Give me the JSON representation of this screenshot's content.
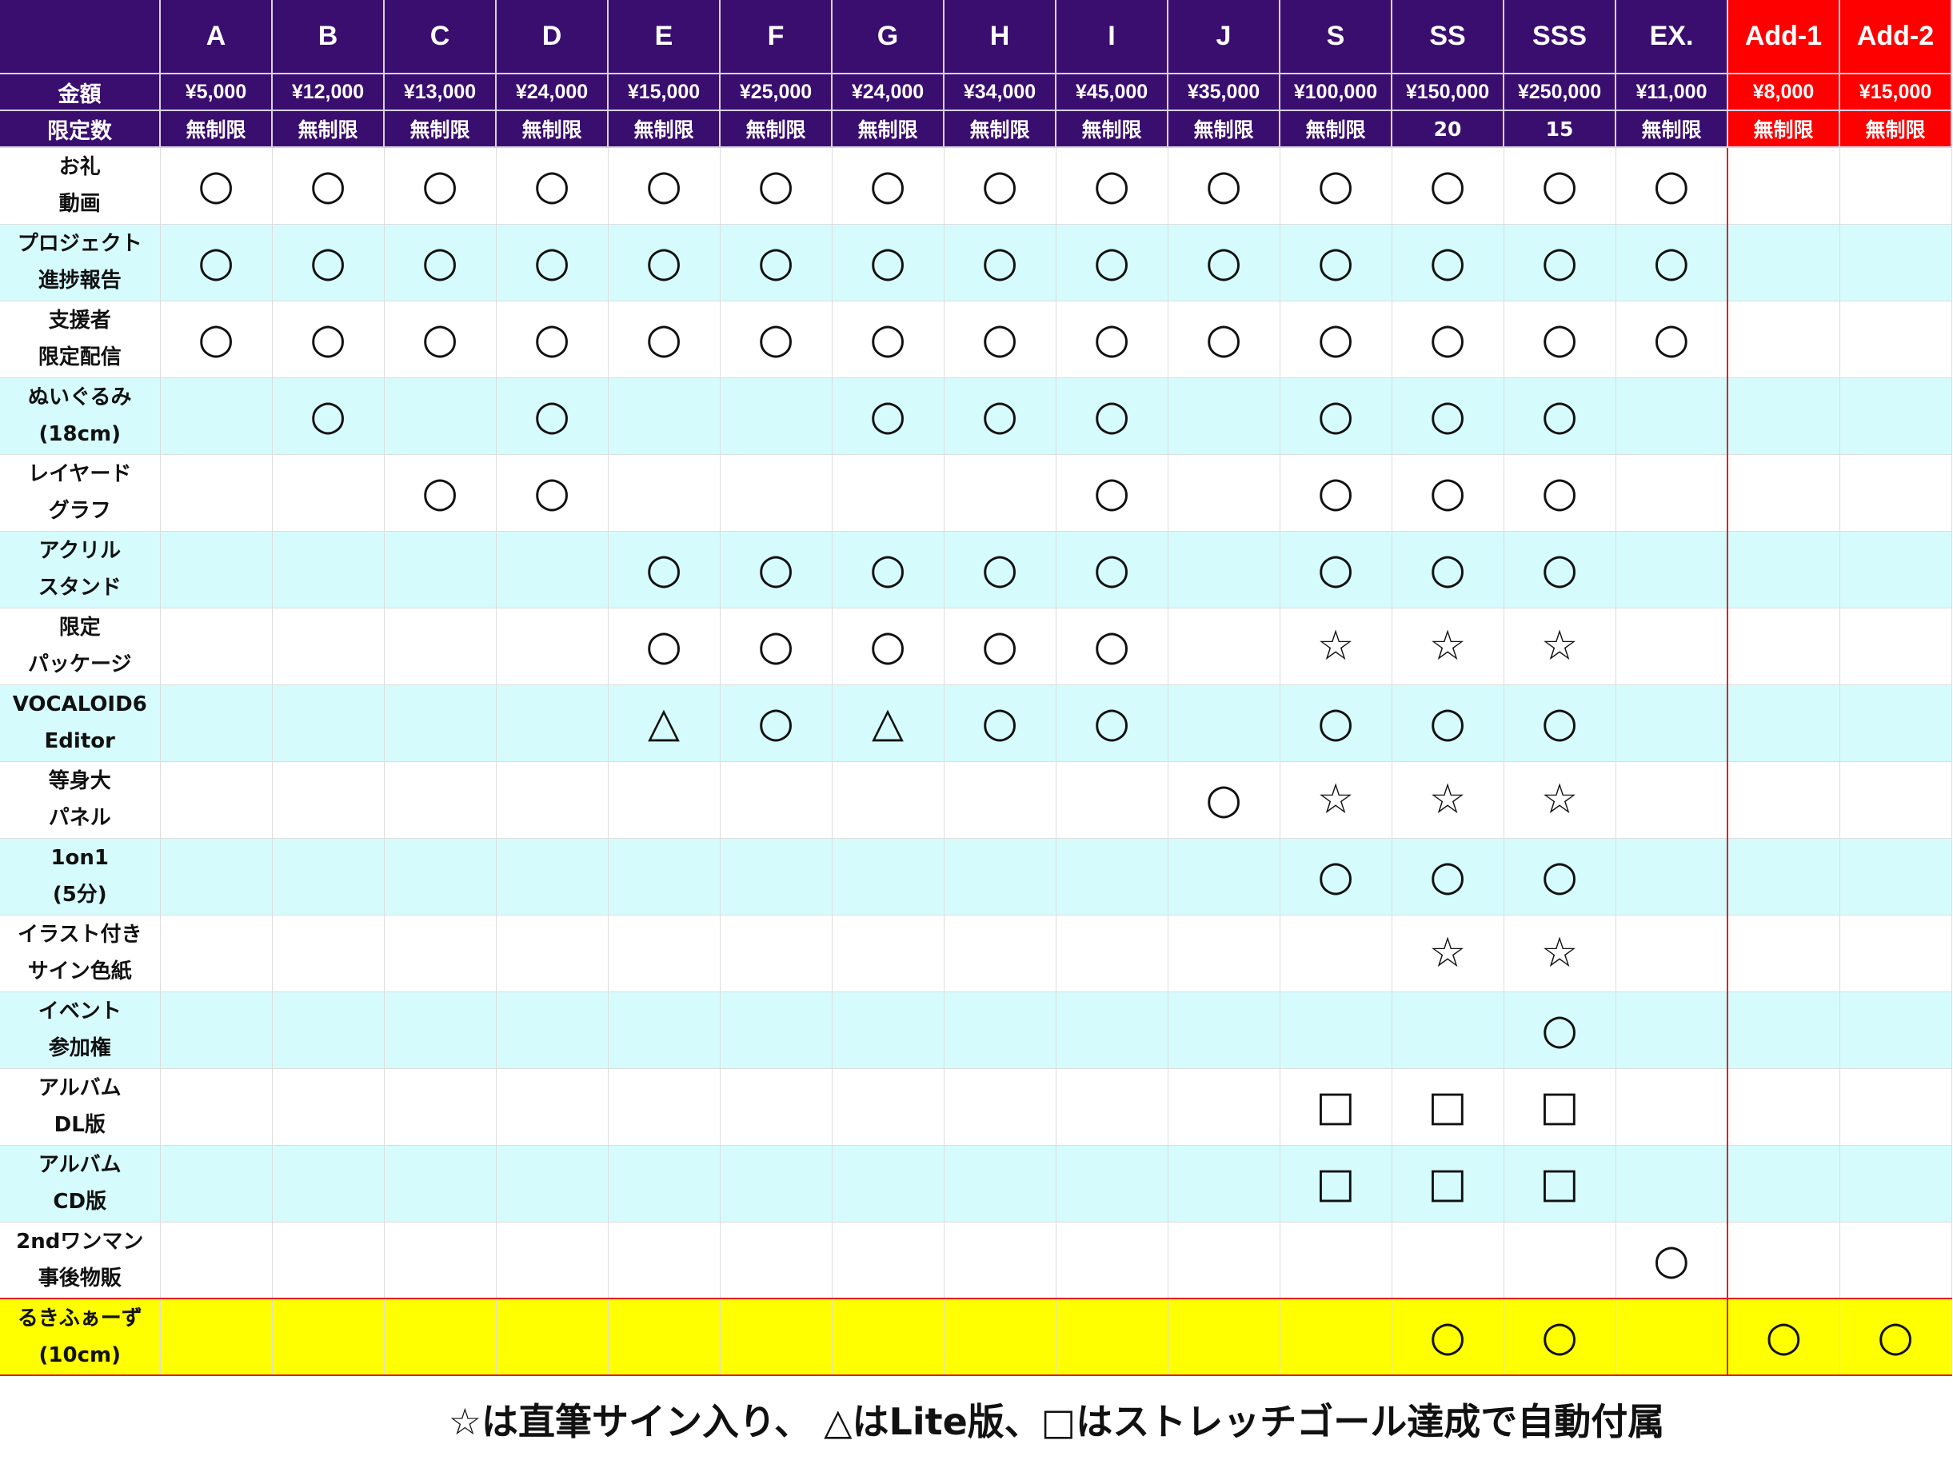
{
  "corner": {
    "price_label": "金額",
    "limit_label": "限定数"
  },
  "tiers": [
    {
      "name": "A",
      "price": "¥5,000",
      "limit": "無制限"
    },
    {
      "name": "B",
      "price": "¥12,000",
      "limit": "無制限"
    },
    {
      "name": "C",
      "price": "¥13,000",
      "limit": "無制限"
    },
    {
      "name": "D",
      "price": "¥24,000",
      "limit": "無制限"
    },
    {
      "name": "E",
      "price": "¥15,000",
      "limit": "無制限"
    },
    {
      "name": "F",
      "price": "¥25,000",
      "limit": "無制限"
    },
    {
      "name": "G",
      "price": "¥24,000",
      "limit": "無制限"
    },
    {
      "name": "H",
      "price": "¥34,000",
      "limit": "無制限"
    },
    {
      "name": "I",
      "price": "¥45,000",
      "limit": "無制限"
    },
    {
      "name": "J",
      "price": "¥35,000",
      "limit": "無制限"
    },
    {
      "name": "S",
      "price": "¥100,000",
      "limit": "無制限"
    },
    {
      "name": "SS",
      "price": "¥150,000",
      "limit": "20"
    },
    {
      "name": "SSS",
      "price": "¥250,000",
      "limit": "15"
    },
    {
      "name": "EX.",
      "price": "¥11,000",
      "limit": "無制限"
    },
    {
      "name": "Add-1",
      "price": "¥8,000",
      "limit": "無制限"
    },
    {
      "name": "Add-2",
      "price": "¥15,000",
      "limit": "無制限"
    }
  ],
  "colors": {
    "header": "#3a0e6f",
    "add_header": "#ff0000",
    "alt_row": "#d6fbfd",
    "highlight_row": "#ffff00",
    "add_border": "#e02020"
  },
  "rows": [
    {
      "label_1": "お礼",
      "label_2": "動画",
      "marks": [
        "○",
        "○",
        "○",
        "○",
        "○",
        "○",
        "○",
        "○",
        "○",
        "○",
        "○",
        "○",
        "○",
        "○",
        "",
        ""
      ]
    },
    {
      "label_1": "プロジェクト",
      "label_2": "進捗報告",
      "marks": [
        "○",
        "○",
        "○",
        "○",
        "○",
        "○",
        "○",
        "○",
        "○",
        "○",
        "○",
        "○",
        "○",
        "○",
        "",
        ""
      ]
    },
    {
      "label_1": "支援者",
      "label_2": "限定配信",
      "marks": [
        "○",
        "○",
        "○",
        "○",
        "○",
        "○",
        "○",
        "○",
        "○",
        "○",
        "○",
        "○",
        "○",
        "○",
        "",
        ""
      ]
    },
    {
      "label_1": "ぬいぐるみ",
      "label_2": "(18cm)",
      "marks": [
        "",
        "○",
        "",
        "○",
        "",
        "",
        "○",
        "○",
        "○",
        "",
        "○",
        "○",
        "○",
        "",
        "",
        ""
      ]
    },
    {
      "label_1": "レイヤード",
      "label_2": "グラフ",
      "marks": [
        "",
        "",
        "○",
        "○",
        "",
        "",
        "",
        "",
        "○",
        "",
        "○",
        "○",
        "○",
        "",
        "",
        ""
      ]
    },
    {
      "label_1": "アクリル",
      "label_2": "スタンド",
      "marks": [
        "",
        "",
        "",
        "",
        "○",
        "○",
        "○",
        "○",
        "○",
        "",
        "○",
        "○",
        "○",
        "",
        "",
        ""
      ]
    },
    {
      "label_1": "限定",
      "label_2": "パッケージ",
      "marks": [
        "",
        "",
        "",
        "",
        "○",
        "○",
        "○",
        "○",
        "○",
        "",
        "☆",
        "☆",
        "☆",
        "",
        "",
        ""
      ]
    },
    {
      "label_1": "VOCALOID6",
      "label_2": "Editor",
      "marks": [
        "",
        "",
        "",
        "",
        "△",
        "○",
        "△",
        "○",
        "○",
        "",
        "○",
        "○",
        "○",
        "",
        "",
        ""
      ]
    },
    {
      "label_1": "等身大",
      "label_2": "パネル",
      "marks": [
        "",
        "",
        "",
        "",
        "",
        "",
        "",
        "",
        "",
        "○",
        "☆",
        "☆",
        "☆",
        "",
        "",
        ""
      ]
    },
    {
      "label_1": "1on1",
      "label_2": "(5分)",
      "marks": [
        "",
        "",
        "",
        "",
        "",
        "",
        "",
        "",
        "",
        "",
        "○",
        "○",
        "○",
        "",
        "",
        ""
      ]
    },
    {
      "label_1": "イラスト付き",
      "label_2": "サイン色紙",
      "marks": [
        "",
        "",
        "",
        "",
        "",
        "",
        "",
        "",
        "",
        "",
        "",
        "☆",
        "☆",
        "",
        "",
        ""
      ]
    },
    {
      "label_1": "イベント",
      "label_2": "参加権",
      "marks": [
        "",
        "",
        "",
        "",
        "",
        "",
        "",
        "",
        "",
        "",
        "",
        "",
        "○",
        "",
        "",
        ""
      ]
    },
    {
      "label_1": "アルバム",
      "label_2": "DL版",
      "marks": [
        "",
        "",
        "",
        "",
        "",
        "",
        "",
        "",
        "",
        "",
        "□",
        "□",
        "□",
        "",
        "",
        ""
      ]
    },
    {
      "label_1": "アルバム",
      "label_2": "CD版",
      "marks": [
        "",
        "",
        "",
        "",
        "",
        "",
        "",
        "",
        "",
        "",
        "□",
        "□",
        "□",
        "",
        "",
        ""
      ]
    },
    {
      "label_1": "2ndワンマン",
      "label_2": "事後物販",
      "marks": [
        "",
        "",
        "",
        "",
        "",
        "",
        "",
        "",
        "",
        "",
        "",
        "",
        "",
        "○",
        "",
        ""
      ]
    },
    {
      "label_1": "るきふぁーず",
      "label_2": "(10cm)",
      "marks": [
        "",
        "",
        "",
        "",
        "",
        "",
        "",
        "",
        "",
        "",
        "",
        "○",
        "○",
        "",
        "○",
        "○"
      ],
      "highlight": true
    }
  ],
  "footer_note": "☆は直筆サイン入り、 △はLite版、□はストレッチゴール達成で自動付属"
}
